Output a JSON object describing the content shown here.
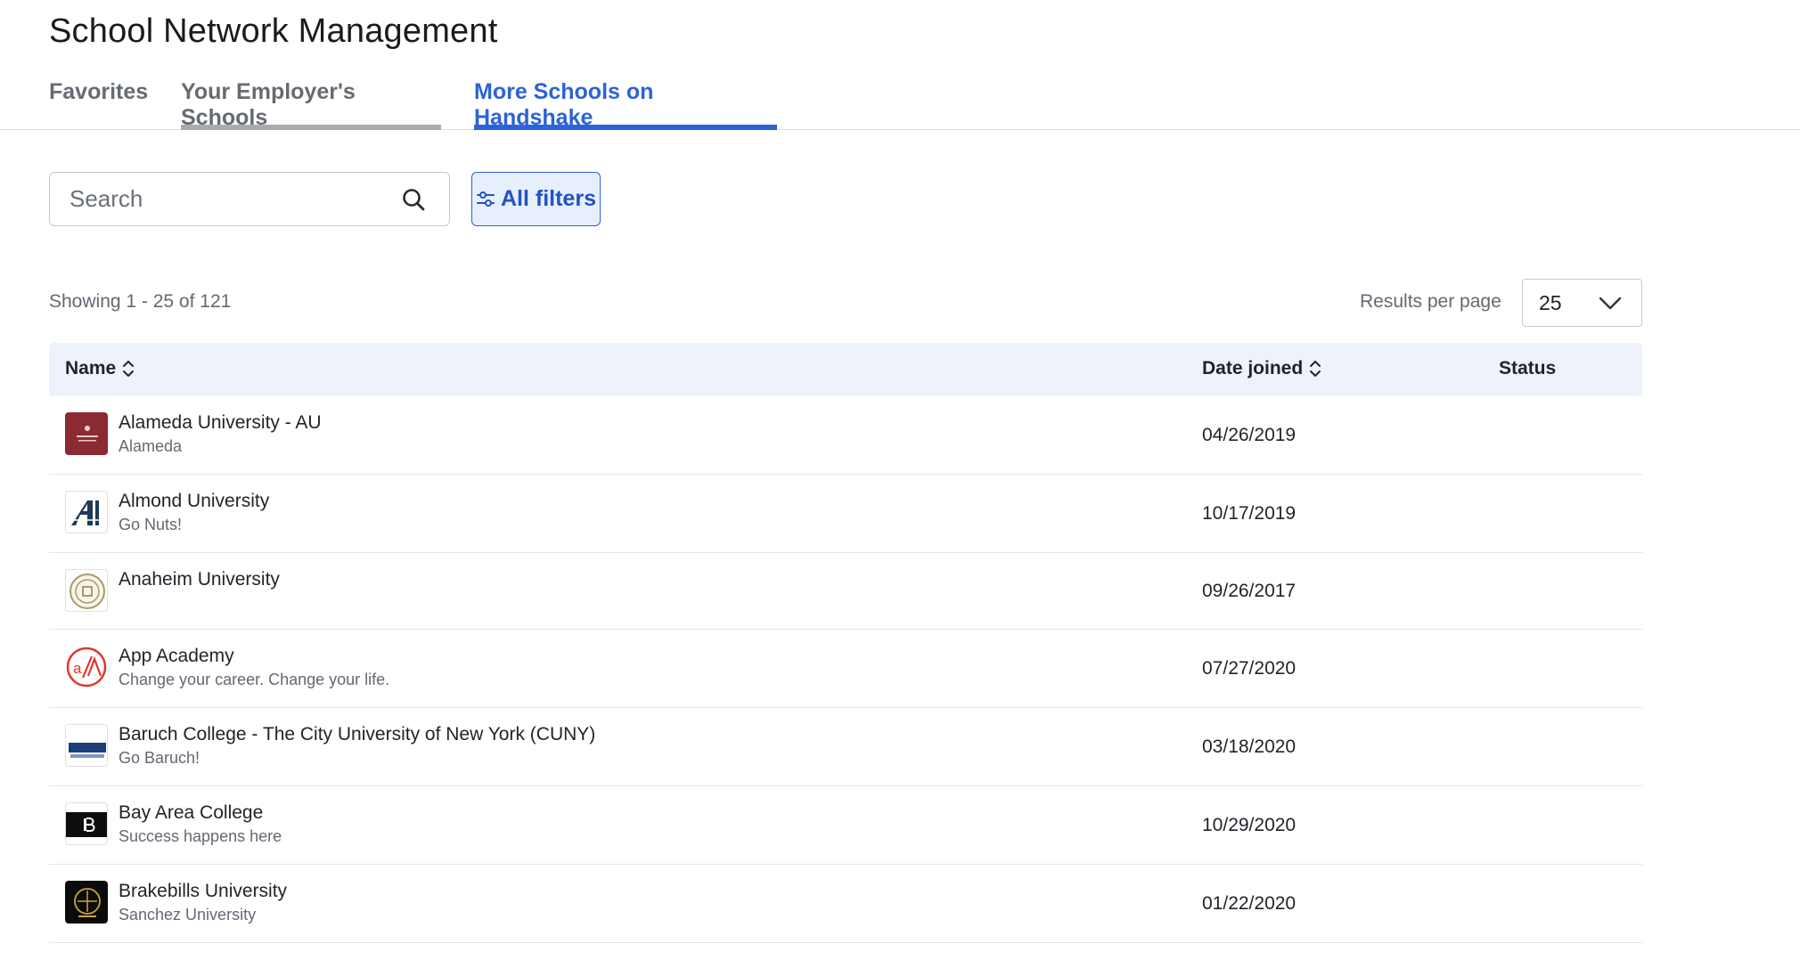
{
  "page": {
    "title": "School Network Management"
  },
  "tabs": [
    {
      "label": "Favorites",
      "state": "default"
    },
    {
      "label": "Your Employer's Schools",
      "state": "hovered"
    },
    {
      "label": "More Schools on Handshake",
      "state": "active"
    }
  ],
  "search": {
    "placeholder": "Search",
    "value": "",
    "icon": "search-icon"
  },
  "filters": {
    "label": "All filters",
    "icon": "sliders-icon"
  },
  "results": {
    "showing_text": "Showing 1 - 25 of 121",
    "per_page_label": "Results per page",
    "per_page_value": "25"
  },
  "table": {
    "columns": {
      "name": "Name",
      "date_joined": "Date joined",
      "status": "Status"
    },
    "rows": [
      {
        "name": "Alameda University - AU",
        "subtitle": "Alameda",
        "date": "04/26/2019",
        "status": ""
      },
      {
        "name": "Almond University",
        "subtitle": "Go Nuts!",
        "date": "10/17/2019",
        "status": ""
      },
      {
        "name": "Anaheim University",
        "subtitle": "",
        "date": "09/26/2017",
        "status": ""
      },
      {
        "name": "App Academy",
        "subtitle": "Change your career. Change your life.",
        "date": "07/27/2020",
        "status": ""
      },
      {
        "name": "Baruch College - The City University of New York (CUNY)",
        "subtitle": "Go Baruch!",
        "date": "03/18/2020",
        "status": ""
      },
      {
        "name": "Bay Area College",
        "subtitle": "Success happens here",
        "date": "10/29/2020",
        "status": ""
      },
      {
        "name": "Brakebills University",
        "subtitle": "Sanchez University",
        "date": "01/22/2020",
        "status": ""
      }
    ]
  },
  "colors": {
    "accent": "#2c63d6",
    "header_bg": "#eef3fb",
    "filters_bg": "#e8effc",
    "muted_text": "#636873"
  }
}
